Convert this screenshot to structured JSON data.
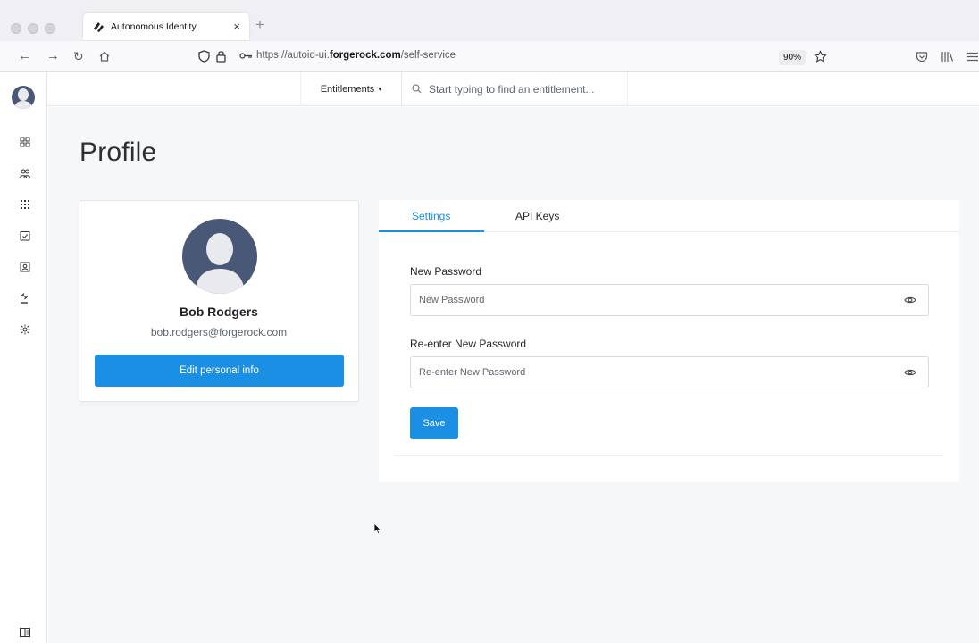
{
  "browser": {
    "tab_title": "Autonomous Identity",
    "tab_close": "×",
    "new_tab": "+",
    "url_prefix": "https://autoid-ui.",
    "url_domain": "forgerock.com",
    "url_path": "/self-service",
    "zoom": "90%"
  },
  "appbar": {
    "entitlements_label": "Entitlements",
    "search_placeholder": "Start typing to find an entitlement..."
  },
  "page": {
    "title": "Profile"
  },
  "profile": {
    "name": "Bob Rodgers",
    "email": "bob.rodgers@forgerock.com",
    "edit_label": "Edit personal info"
  },
  "settings": {
    "tabs": [
      {
        "label": "Settings"
      },
      {
        "label": "API Keys"
      }
    ],
    "new_password_label": "New Password",
    "new_password_placeholder": "New Password",
    "reenter_label": "Re-enter New Password",
    "reenter_placeholder": "Re-enter New Password",
    "save_label": "Save"
  },
  "colors": {
    "accent": "#1a8fe3",
    "avatar_bg": "#4a5878"
  }
}
